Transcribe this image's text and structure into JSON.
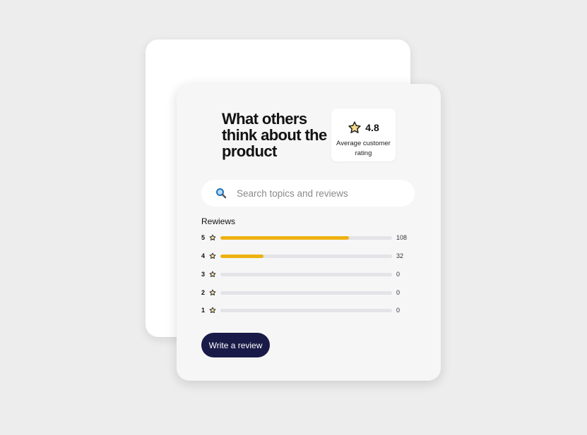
{
  "headline": "What others think about the product",
  "rating": {
    "value": "4.8",
    "caption": "Average customer rating",
    "icon": "star-icon"
  },
  "search": {
    "placeholder": "Search topics and reviews",
    "icon": "search-icon"
  },
  "reviews": {
    "label": "Rewiews",
    "rows": [
      {
        "stars": "5",
        "count": "108",
        "fraction": 0.75
      },
      {
        "stars": "4",
        "count": "32",
        "fraction": 0.25
      },
      {
        "stars": "3",
        "count": "0",
        "fraction": 0
      },
      {
        "stars": "2",
        "count": "0",
        "fraction": 0
      },
      {
        "stars": "1",
        "count": "0",
        "fraction": 0
      }
    ]
  },
  "write_button": "Write a review",
  "colors": {
    "accent": "#edb211",
    "button": "#191a47",
    "track": "#e3e3e8"
  }
}
